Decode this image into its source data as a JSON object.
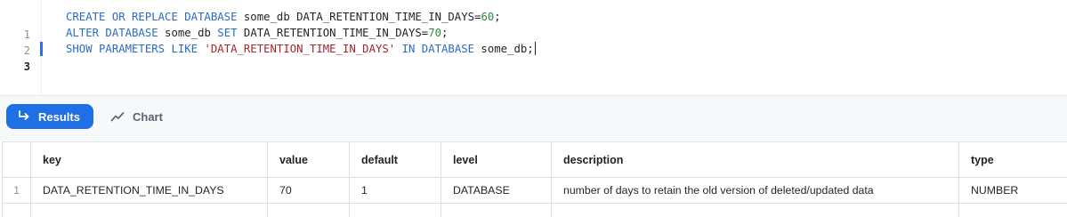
{
  "editor": {
    "lines": [
      {
        "number": "1",
        "tokens": [
          {
            "t": "CREATE OR REPLACE DATABASE",
            "c": "kw"
          },
          {
            "t": " some_db DATA_RETENTION_TIME_IN_DAYS=",
            "c": "id"
          },
          {
            "t": "60",
            "c": "num"
          },
          {
            "t": ";",
            "c": "id"
          }
        ]
      },
      {
        "number": "2",
        "tokens": [
          {
            "t": "ALTER DATABASE",
            "c": "kw"
          },
          {
            "t": " some_db ",
            "c": "id"
          },
          {
            "t": "SET",
            "c": "kw"
          },
          {
            "t": " DATA_RETENTION_TIME_IN_DAYS=",
            "c": "id"
          },
          {
            "t": "70",
            "c": "num"
          },
          {
            "t": ";",
            "c": "id"
          }
        ]
      },
      {
        "number": "3",
        "active": true,
        "tokens": [
          {
            "t": "SHOW PARAMETERS LIKE",
            "c": "kw"
          },
          {
            "t": " ",
            "c": "id"
          },
          {
            "t": "'DATA_RETENTION_TIME_IN_DAYS'",
            "c": "str"
          },
          {
            "t": " ",
            "c": "id"
          },
          {
            "t": "IN DATABASE",
            "c": "kw"
          },
          {
            "t": " some_db;",
            "c": "id"
          }
        ]
      }
    ]
  },
  "tabs": {
    "results_label": "Results",
    "chart_label": "Chart",
    "active": "results"
  },
  "icons": {
    "results": "return-arrow-icon",
    "chart": "trend-line-icon"
  },
  "colors": {
    "accent": "#1f6fe5",
    "keyword": "#2a6cc1",
    "number": "#2c8a3e",
    "string": "#a3252e"
  },
  "results": {
    "columns": [
      "key",
      "value",
      "default",
      "level",
      "description",
      "type"
    ],
    "rows": [
      {
        "rownum": "1",
        "key": "DATA_RETENTION_TIME_IN_DAYS",
        "value": "70",
        "default": "1",
        "level": "DATABASE",
        "description": "number of days to retain the old version of deleted/updated data",
        "type": "NUMBER"
      }
    ]
  }
}
